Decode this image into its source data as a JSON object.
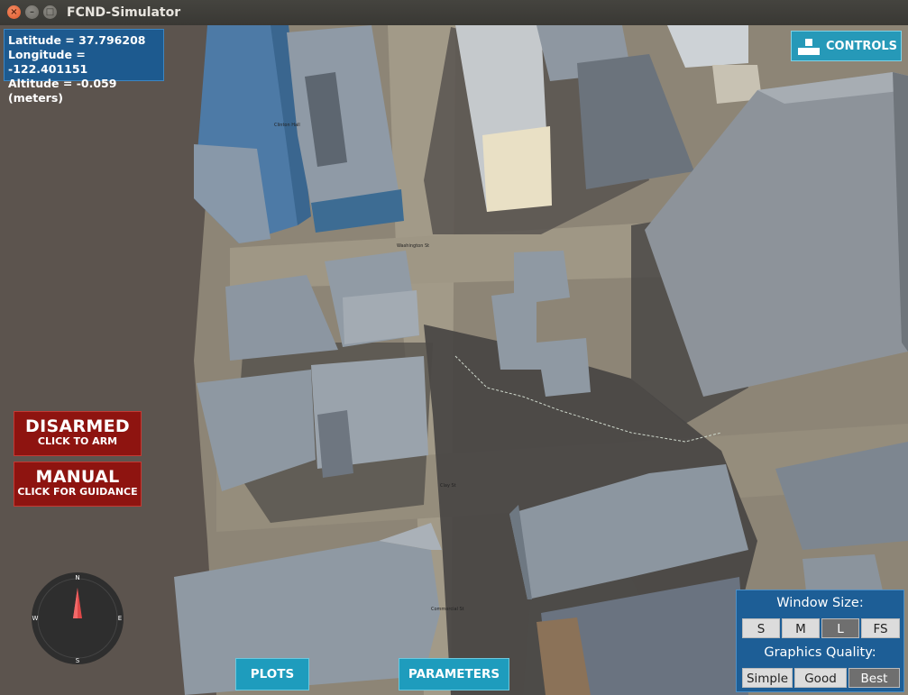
{
  "window": {
    "title": "FCND-Simulator"
  },
  "position": {
    "latitude": "Latitude = 37.796208",
    "longitude": "Longitude = -122.401151",
    "altitude": "Altitude = -0.059 (meters)"
  },
  "controls_button": {
    "label": "CONTROLS",
    "icon": "controls-keys-icon"
  },
  "arm_button": {
    "title": "DISARMED",
    "subtitle": "CLICK TO ARM"
  },
  "mode_button": {
    "title": "MANUAL",
    "subtitle": "CLICK FOR GUIDANCE"
  },
  "compass": {
    "n": "N",
    "s": "S",
    "e": "E",
    "w": "W"
  },
  "bottom_buttons": {
    "plots": "PLOTS",
    "parameters": "PARAMETERS"
  },
  "settings": {
    "window_size_label": "Window Size:",
    "window_sizes": [
      "S",
      "M",
      "L",
      "FS"
    ],
    "window_size_selected": "L",
    "graphics_label": "Graphics Quality:",
    "graphics": [
      "Simple",
      "Good",
      "Best"
    ],
    "graphics_selected": "Best"
  },
  "map_labels": [
    "Clinton Hall",
    "Washington St",
    "Clay St",
    "Commercial St"
  ]
}
